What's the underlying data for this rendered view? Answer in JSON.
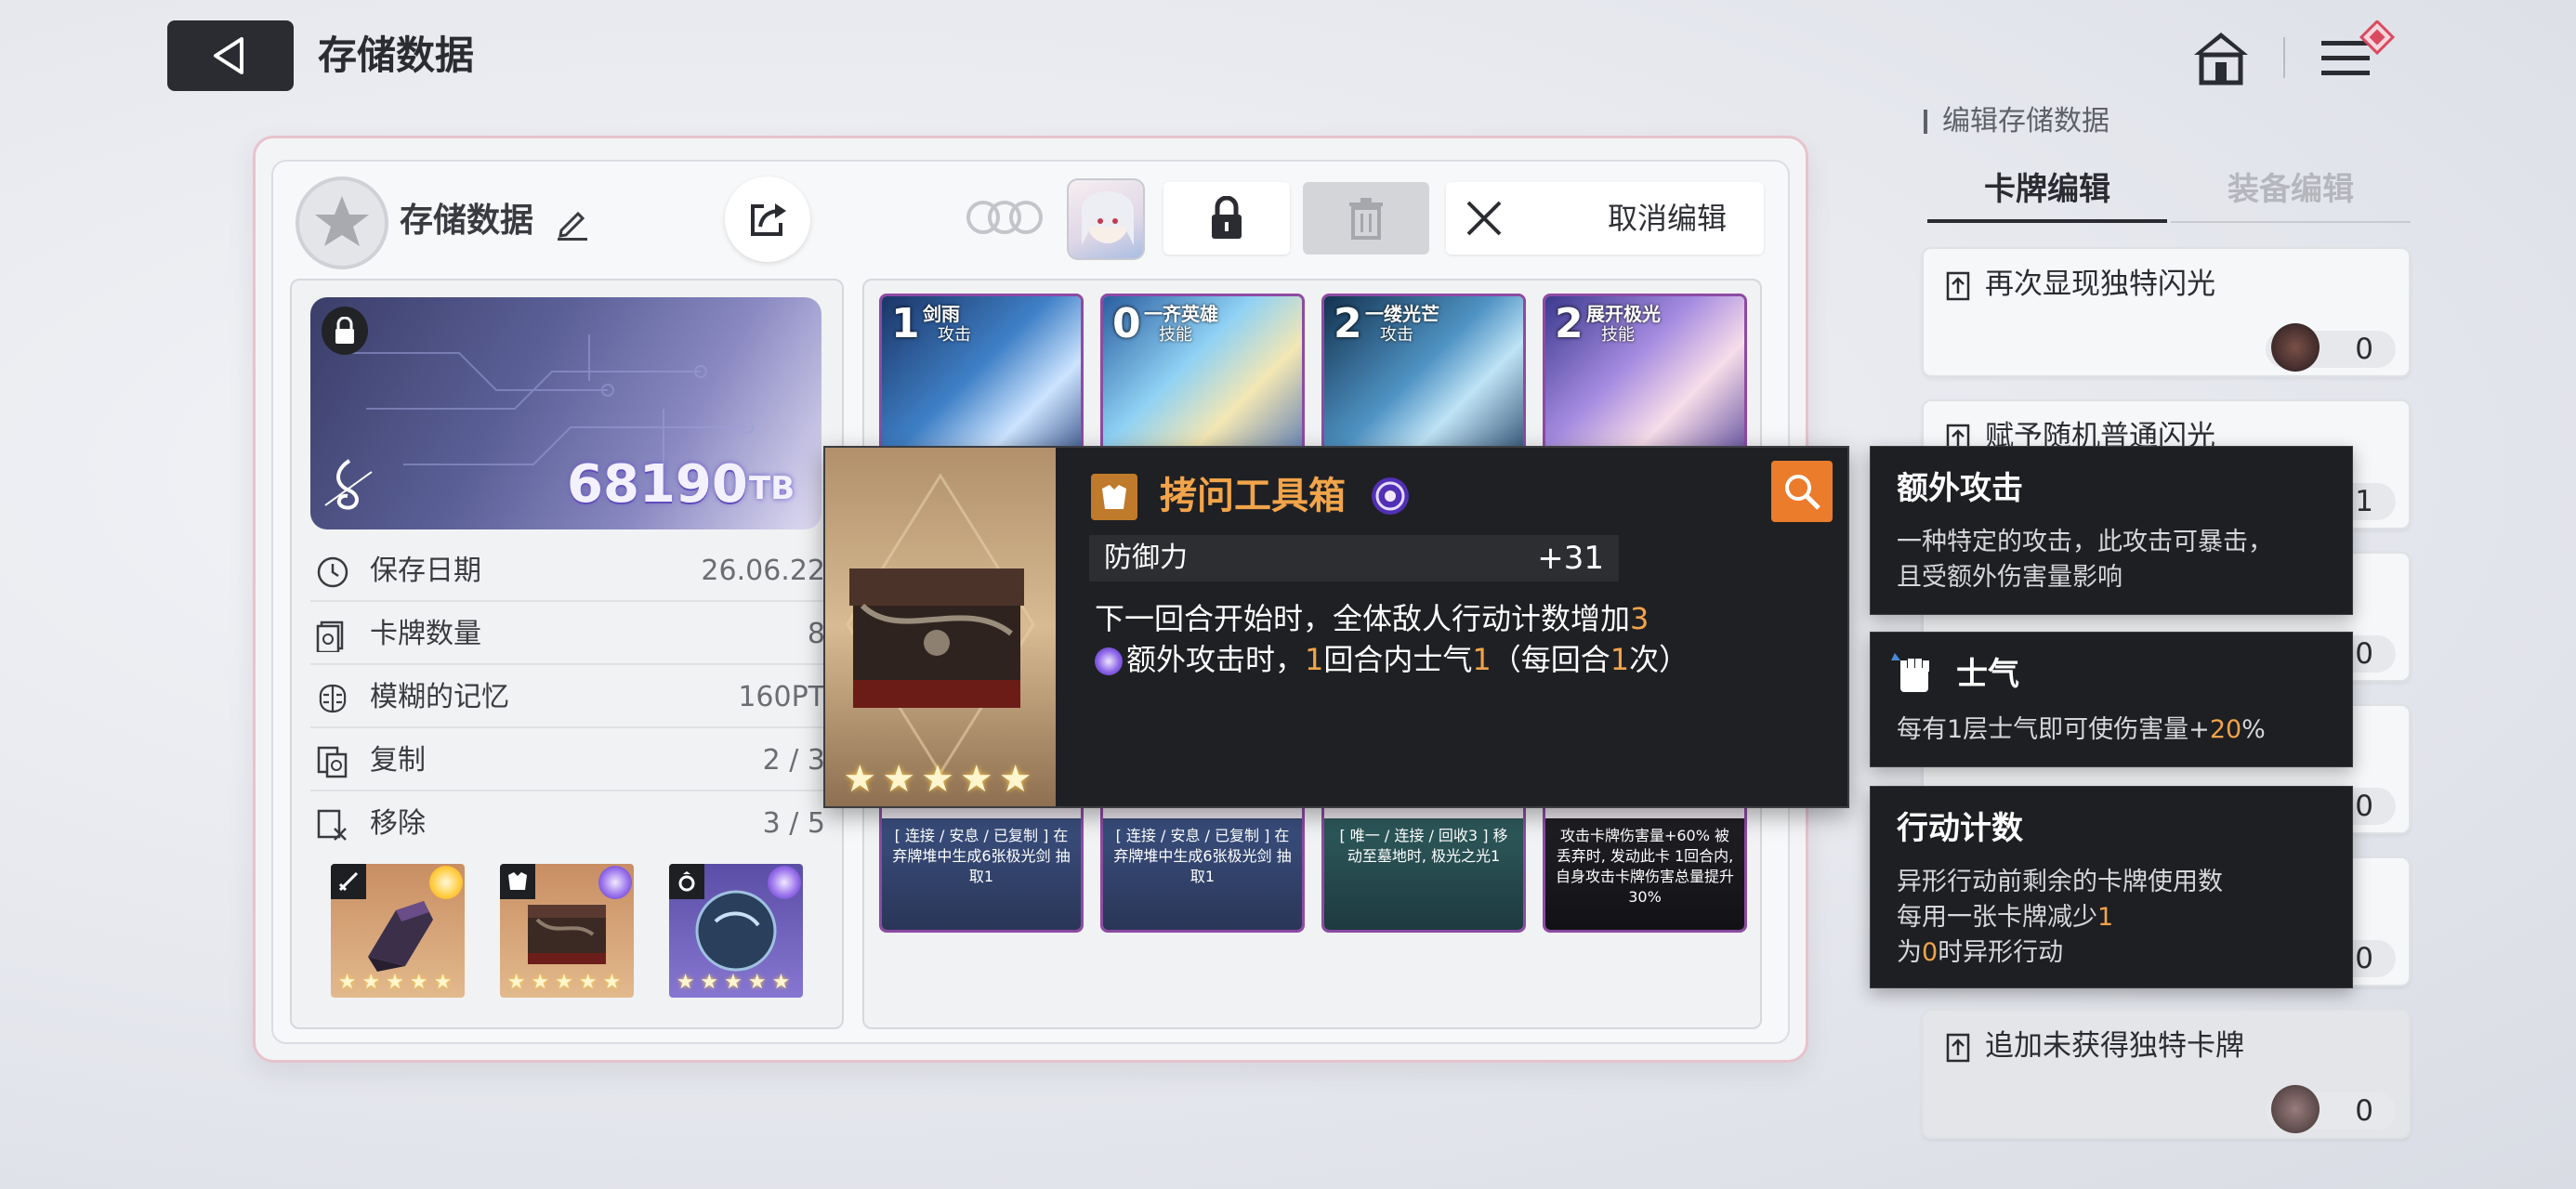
{
  "header": {
    "title": "存储数据",
    "back_icon": "back-triangle-icon",
    "home_icon": "home-icon",
    "menu_icon": "menu-icon"
  },
  "save": {
    "name": "存储数据",
    "tb_amount": "68190",
    "tb_unit": "TB",
    "cancel_edit_label": "取消编辑",
    "stats": [
      {
        "label": "保存日期",
        "value": "26.06.22",
        "icon": "clock-icon"
      },
      {
        "label": "卡牌数量",
        "value": "8",
        "icon": "card-count-icon"
      },
      {
        "label": "模糊的记忆",
        "value": "160PT",
        "icon": "brain-icon"
      },
      {
        "label": "复制",
        "value": "2 / 3",
        "icon": "copy-icon"
      },
      {
        "label": "移除",
        "value": "3 / 5",
        "icon": "remove-icon"
      }
    ],
    "equipment_stars": [
      "★★★★★",
      "★★★★★",
      "★★★★★"
    ]
  },
  "cards": [
    {
      "cost": "1",
      "name": "剑雨",
      "type": "攻击",
      "desc": "[ 连接 / 安息 / 已复制 ] 在弃牌堆中生成6张极光剑 抽取1"
    },
    {
      "cost": "0",
      "name": "一齐英雄",
      "type": "技能",
      "desc": "[ 连接 / 安息 / 已复制 ] 在弃牌堆中生成6张极光剑 抽取1"
    },
    {
      "cost": "2",
      "name": "一缕光芒",
      "type": "攻击",
      "desc": "[ 唯一 / 连接 / 回收3 ] 移动至墓地时, 极光之光1"
    },
    {
      "cost": "2",
      "name": "展开极光",
      "type": "技能",
      "desc": "攻击卡牌伤害量+60% 被丢弃时, 发动此卡 1回合内, 自身攻击卡牌伤害总量提升30%"
    }
  ],
  "item_popup": {
    "name": "拷问工具箱",
    "stat_label": "防御力",
    "stat_value": "+31",
    "desc_line1_pre": "下一回合开始时，全体敌人行动计数增加",
    "desc_line1_num": "3",
    "desc_line2_a": "额外攻击时，",
    "desc_line2_b": "1",
    "desc_line2_c": "回合内士气",
    "desc_line2_d": "1",
    "desc_line2_e": "（每回合",
    "desc_line2_f": "1",
    "desc_line2_g": "次）",
    "stars": "★★★★★"
  },
  "keywords": [
    {
      "title": "额外攻击",
      "lines": [
        "一种特定的攻击，此攻击可暴击，",
        "且受额外伤害量影响"
      ]
    },
    {
      "title": "士气",
      "text_pre": "每有1层士气即可使伤害量+",
      "text_num": "20",
      "text_post": "%"
    },
    {
      "title": "行动计数",
      "line1": "异形行动前剩余的卡牌使用数",
      "line2_pre": "每用一张卡牌减少",
      "line2_num": "1",
      "line3_pre": "为",
      "line3_num": "0",
      "line3_post": "时异形行动"
    }
  ],
  "right_panel": {
    "section_title": "编辑存储数据",
    "tabs": [
      "卡牌编辑",
      "装备编辑"
    ],
    "options": [
      {
        "label": "再次显现独特闪光",
        "count": "0"
      },
      {
        "label": "赋予随机普通闪光",
        "count": "1"
      },
      {
        "label": "",
        "count": "0"
      },
      {
        "label": "",
        "count": "0"
      },
      {
        "label": "",
        "count": "0"
      },
      {
        "label": "追加未获得独特卡牌",
        "count": "0"
      }
    ]
  },
  "colors": {
    "accent_orange": "#f2a44a",
    "dark_panel": "#1f2023",
    "panel_border_pink": "#e7c3cc"
  }
}
